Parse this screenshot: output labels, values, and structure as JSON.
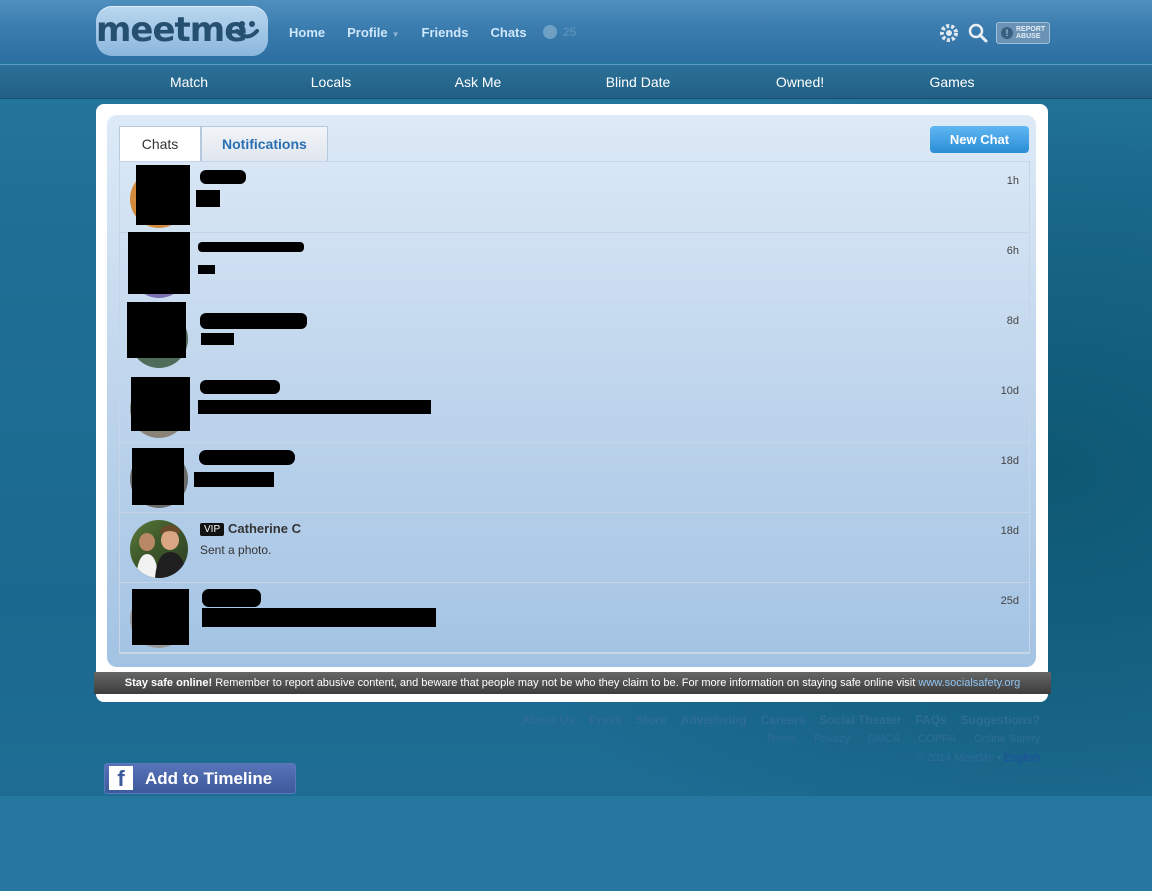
{
  "header": {
    "logo_text": "meetme",
    "nav": [
      {
        "label": "Home"
      },
      {
        "label": "Profile",
        "has_dropdown": true
      },
      {
        "label": "Friends"
      },
      {
        "label": "Chats"
      }
    ],
    "online_count": "25",
    "report_label_1": "REPORT",
    "report_label_2": "ABUSE"
  },
  "subnav": [
    "Match",
    "Locals",
    "Ask Me",
    "Blind Date",
    "Owned!",
    "Games"
  ],
  "tabs": {
    "chats": "Chats",
    "notifications": "Notifications"
  },
  "new_chat_label": "New Chat",
  "chats": [
    {
      "time": "1h",
      "redacted": true
    },
    {
      "time": "6h",
      "redacted": true
    },
    {
      "time": "8d",
      "redacted": true
    },
    {
      "time": "10d",
      "redacted": true
    },
    {
      "time": "18d",
      "redacted": true
    },
    {
      "time": "18d",
      "vip": "VIP",
      "name": "Catherine C",
      "message": "Sent a photo."
    },
    {
      "time": "25d",
      "redacted": true
    }
  ],
  "safety": {
    "bold": "Stay safe online!",
    "text": " Remember to report abusive content, and beware that people may not be who they claim to be. For more information on staying safe online visit ",
    "link": "www.socialsafety.org"
  },
  "footer": {
    "links_row1": [
      "About Us",
      "Press",
      "Store",
      "Advertising",
      "Careers",
      "Social Theater",
      "FAQs",
      "Suggestions?"
    ],
    "links_row2": [
      "Terms",
      "Privacy",
      "DMCA",
      "COPPA",
      "Online Safety"
    ],
    "copyright": "© 2014 MeetMe •",
    "language": "English"
  },
  "facebook_button": "Add to Timeline",
  "colors": {
    "accent": "#2c8ed6",
    "tab_link": "#2a6eb2",
    "footer_text": "#2e6c95"
  }
}
